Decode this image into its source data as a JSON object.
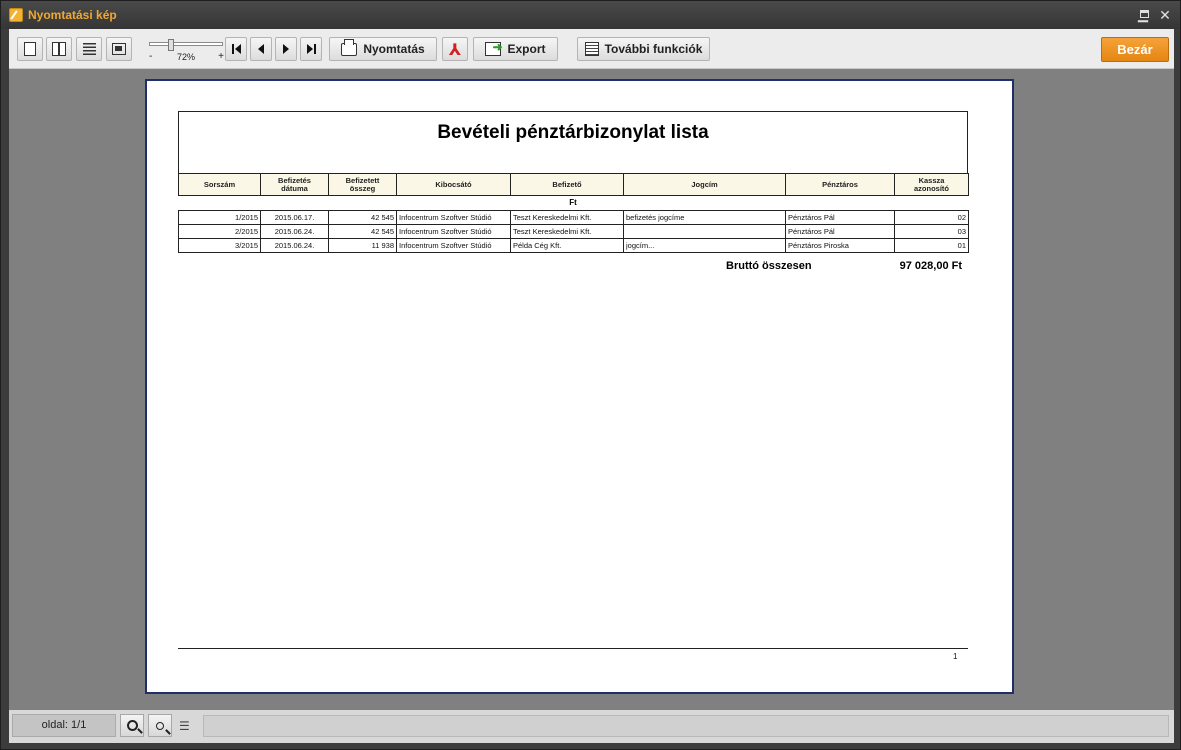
{
  "window": {
    "title": "Nyomtatási kép",
    "minimize_icon": "minimize-icon",
    "maximize_icon": "maximize-icon",
    "close_icon": "close-icon"
  },
  "toolbar": {
    "zoom": {
      "min_label": "-",
      "max_label": "+",
      "value": "72%",
      "level": 0.28
    },
    "print_label": "Nyomtatás",
    "export_label": "Export",
    "more_label": "További funkciók",
    "close_label": "Bezár"
  },
  "report": {
    "title": "Bevételi pénztárbizonylat lista",
    "columns": [
      {
        "l1": "Sorszám",
        "l2": ""
      },
      {
        "l1": "Befizetés",
        "l2": "dátuma"
      },
      {
        "l1": "Befizetett",
        "l2": "összeg"
      },
      {
        "l1": "Kibocsátó",
        "l2": ""
      },
      {
        "l1": "Befizető",
        "l2": ""
      },
      {
        "l1": "Jogcím",
        "l2": ""
      },
      {
        "l1": "Pénztáros",
        "l2": ""
      },
      {
        "l1": "Kassza",
        "l2": "azonosító"
      }
    ],
    "currency": "Ft",
    "rows": [
      [
        "1/2015",
        "2015.06.17.",
        "42 545",
        "Infocentrum Szoftver Stúdió",
        "Teszt Kereskedelmi Kft.",
        "befizetés jogcíme",
        "Pénztáros Pál",
        "02"
      ],
      [
        "2/2015",
        "2015.06.24.",
        "42 545",
        "Infocentrum Szoftver Stúdió",
        "Teszt Kereskedelmi Kft.",
        "",
        "Pénztáros Pál",
        "03"
      ],
      [
        "3/2015",
        "2015.06.24.",
        "11 938",
        "Infocentrum Szoftver Stúdió",
        "Példa Cég Kft.",
        "jogcím...",
        "Pénztáros Piroska",
        "01"
      ]
    ],
    "total_label": "Bruttó összesen",
    "total_value": "97 028,00 Ft",
    "page_number": "1"
  },
  "statusbar": {
    "page_indicator": "oldal: 1/1"
  }
}
